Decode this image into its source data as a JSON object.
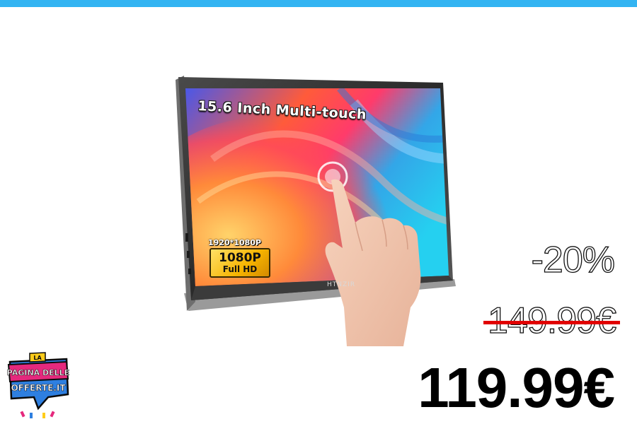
{
  "colors": {
    "top_bar": "#33b4f2",
    "strike": "#e10000",
    "logo_blue": "#2e7fe0",
    "logo_pink": "#e5297d",
    "logo_yellow": "#ffcc1a"
  },
  "product": {
    "screen_caption": "15.6 Inch Multi-touch",
    "resolution_label": "1920*1080P",
    "badge_big": "1080P",
    "badge_small": "Full HD",
    "brand": "HTNZIR"
  },
  "pricing": {
    "discount": "-20%",
    "old_price": "149.99€",
    "new_price": "119.99€"
  },
  "logo": {
    "lettering": [
      "LA",
      "PAGINA DELLE",
      "OFFERTE.IT"
    ]
  }
}
